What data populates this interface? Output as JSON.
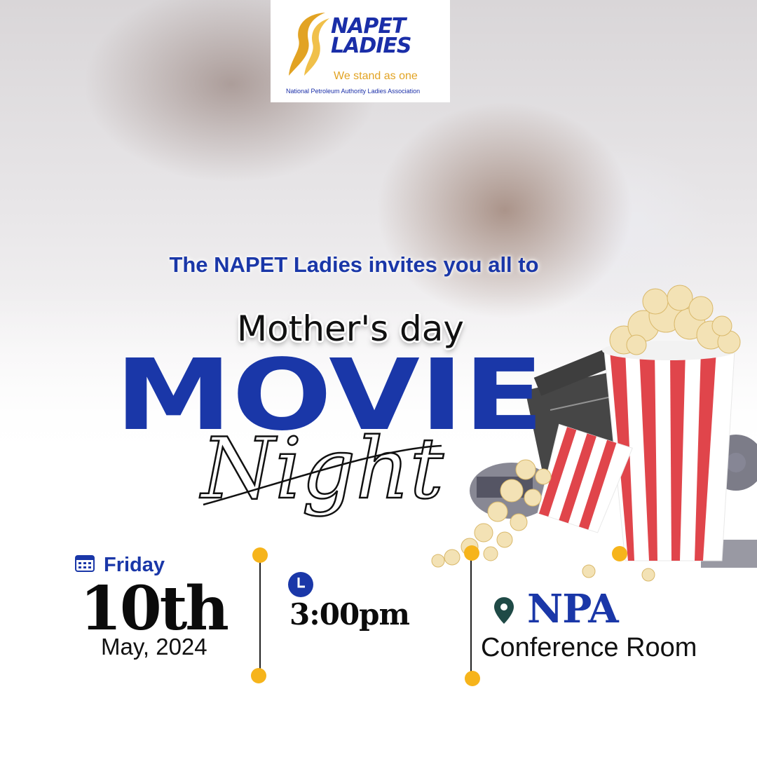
{
  "logo": {
    "line1": "NAPET",
    "line2": "LADIES",
    "tagline": "We stand as one",
    "subtitle": "National Petroleum Authority Ladies Association"
  },
  "headline": {
    "invite": "The NAPET Ladies invites you all to",
    "occasion": "Mother's day",
    "title": "MOVIE",
    "script": "Night"
  },
  "details": {
    "weekday": "Friday",
    "day": "10th",
    "month_year": "May, 2024",
    "time": "3:00pm",
    "venue": "NPA",
    "room": "Conference Room"
  },
  "colors": {
    "brand_blue": "#1a37a8",
    "accent_yellow": "#f6b41b",
    "logo_gold": "#e2a323",
    "popcorn_red": "#e0454b"
  },
  "icons": {
    "calendar": "calendar-icon",
    "clock": "clock-icon",
    "location": "location-pin-icon"
  }
}
